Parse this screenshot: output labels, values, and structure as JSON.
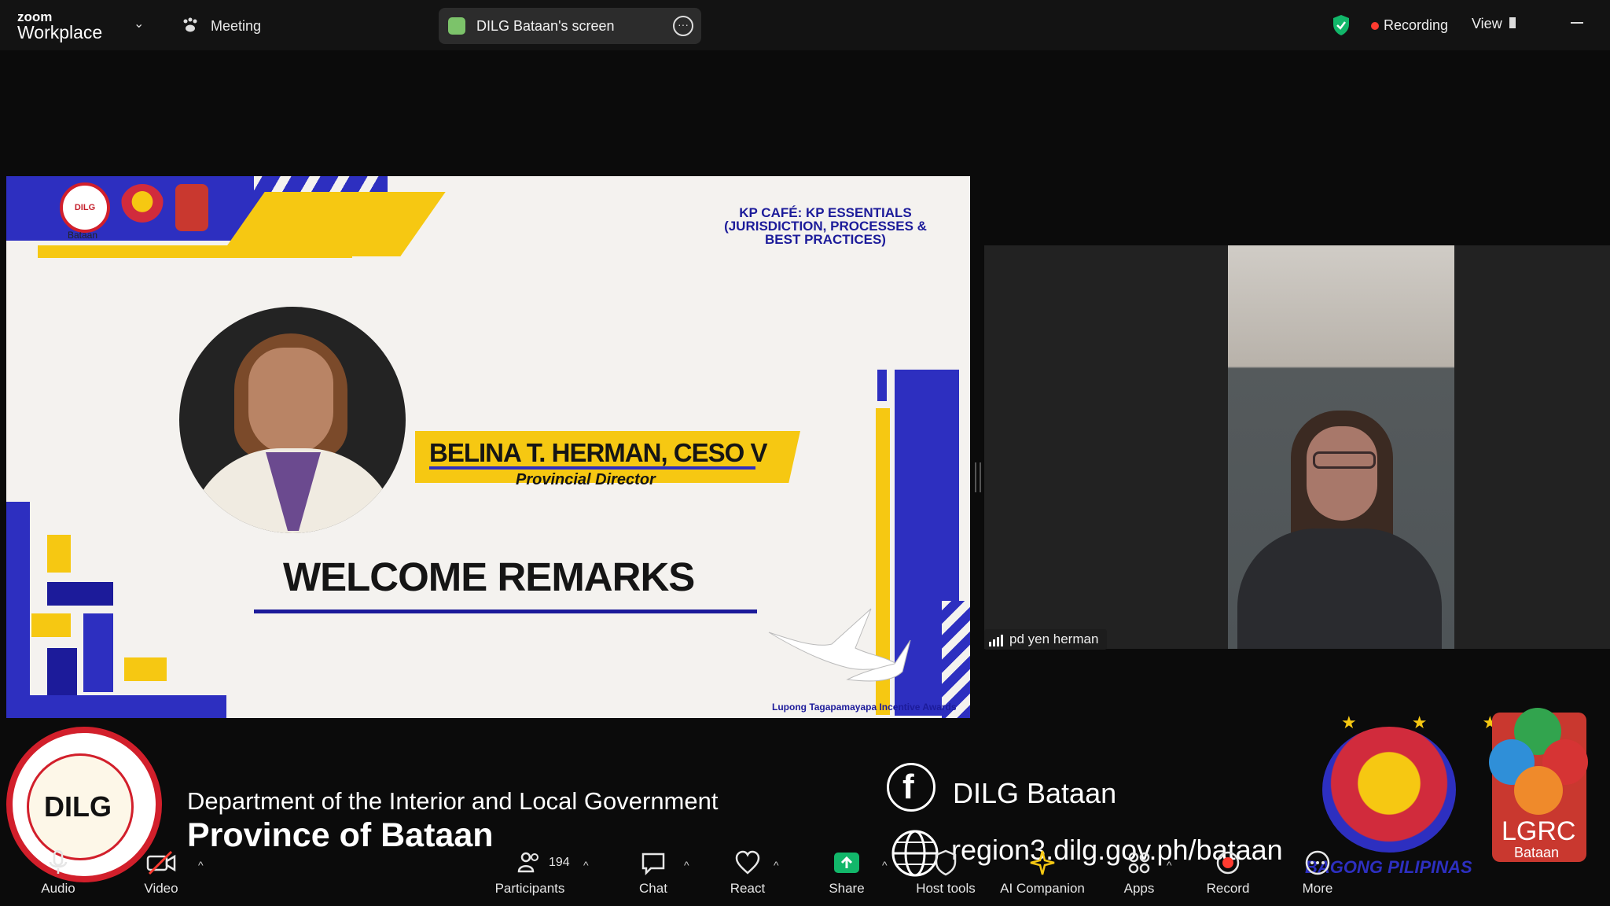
{
  "topbar": {
    "brand_small": "zoom",
    "brand": "Workplace",
    "meeting_label": "Meeting",
    "screen_share_label": "DILG Bataan's screen",
    "recording_label": "Recording",
    "view_label": "View"
  },
  "slide": {
    "logo_text": "DILG",
    "logo_caption": "Bataan",
    "series_title": "KP CAFÉ: KP ESSENTIALS (JURISDICTION, PROCESSES & BEST PRACTICES)",
    "speaker_name": "BELINA T. HERMAN, CESO V",
    "speaker_role": "Provincial Director",
    "headline": "WELCOME REMARKS",
    "footer": "Lupong Tagapamayapa Incentive Awards"
  },
  "participant": {
    "name": "pd yen herman"
  },
  "overlay": {
    "seal_text": "DILG",
    "department": "Department of the Interior and Local Government",
    "province": "Province of Bataan",
    "facebook_label": "DILG Bataan",
    "website": "region3.dilg.gov.ph/bataan",
    "bagong_label": "BAGONG PILIPINAS",
    "lgrc_label": "LGRC",
    "lgrc_sub": "Bataan"
  },
  "toolbar": {
    "audio": "Audio",
    "video": "Video",
    "participants": "Participants",
    "participant_count": "194",
    "chat": "Chat",
    "react": "React",
    "share": "Share",
    "host_tools": "Host tools",
    "ai_companion": "AI Companion",
    "apps": "Apps",
    "record": "Record",
    "more": "More"
  },
  "colors": {
    "brand_blue": "#2d2fc0",
    "brand_yellow": "#f6c812",
    "recording_red": "#ff3b30",
    "share_green": "#12b76a"
  }
}
